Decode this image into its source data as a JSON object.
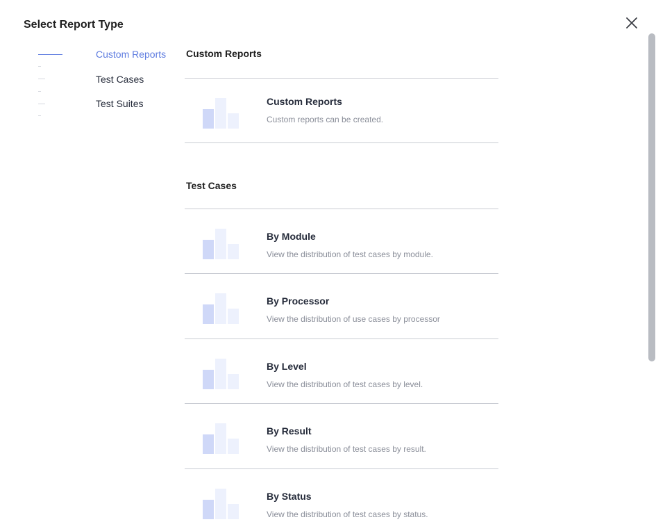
{
  "dialog": {
    "title": "Select Report Type",
    "close_icon": "close-icon"
  },
  "nav": {
    "items": [
      {
        "label": "Custom Reports",
        "active": true
      },
      {
        "label": "Test Cases",
        "active": false
      },
      {
        "label": "Test Suites",
        "active": false
      }
    ]
  },
  "sections": [
    {
      "title": "Custom Reports",
      "cards": [
        {
          "name": "Custom Reports",
          "description": "Custom reports can be created.",
          "icon": "bar-chart-icon"
        }
      ]
    },
    {
      "title": "Test Cases",
      "cards": [
        {
          "name": "By Module",
          "description": "View the distribution of test cases by module.",
          "icon": "bar-chart-icon"
        },
        {
          "name": "By Processor",
          "description": "View the distribution of use cases by processor",
          "icon": "bar-chart-icon"
        },
        {
          "name": "By Level",
          "description": "View the distribution of test cases by level.",
          "icon": "bar-chart-icon"
        },
        {
          "name": "By Result",
          "description": "View the distribution of test cases by result.",
          "icon": "bar-chart-icon"
        },
        {
          "name": "By Status",
          "description": "View the distribution of test cases by status.",
          "icon": "bar-chart-icon"
        }
      ]
    }
  ],
  "colors": {
    "accent": "#5e7ce0",
    "text": "#252b3a",
    "muted": "#8a8e99",
    "divider": "#c9ccd3",
    "bar_primary": "#cfd8f8",
    "bar_light": "#edf1fd"
  }
}
